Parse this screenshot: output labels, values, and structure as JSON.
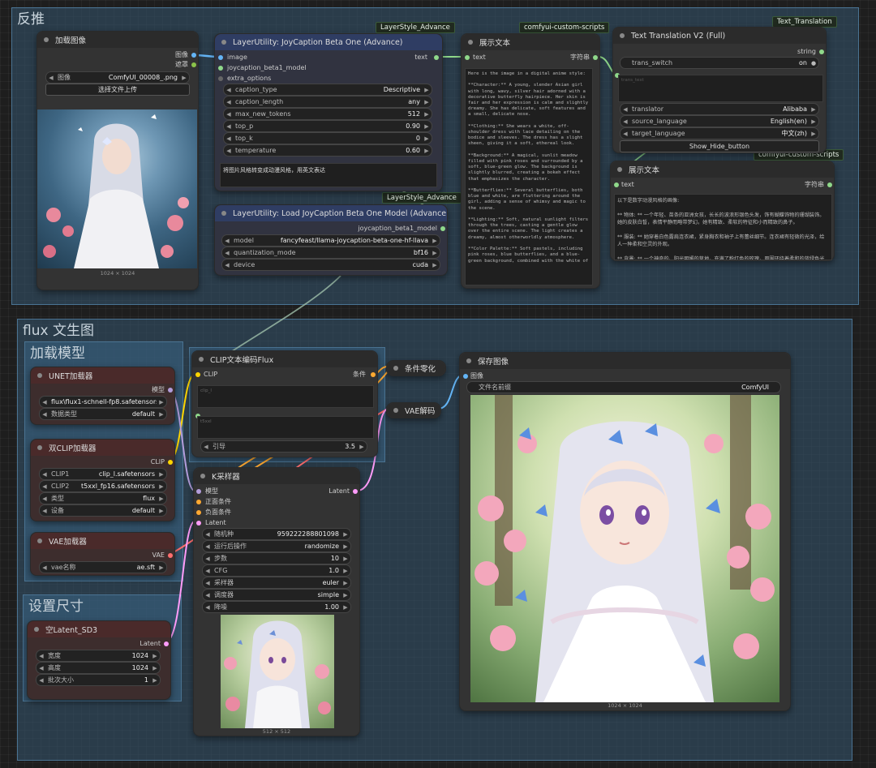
{
  "groups": {
    "reverse": "反推",
    "flux": "flux 文生图",
    "load_model": "加载模型",
    "size": "设置尺寸"
  },
  "badges": {
    "ls_adv_1": "LayerStyle_Advance",
    "ls_adv_2": "LayerStyle_Advance",
    "ccs_1": "comfyui-custom-scripts",
    "ccs_2": "comfyui-custom-scripts",
    "text_translation": "Text_Translation"
  },
  "load_image": {
    "title": "加载图像",
    "out_image": "图像",
    "out_mask": "遮罩",
    "image_label": "图像",
    "image_value": "ComfyUI_00008_.png",
    "upload": "选择文件上传",
    "size": "1024 × 1024"
  },
  "joycap": {
    "title": "LayerUtility: JoyCaption Beta One (Advance)",
    "in_image": "image",
    "in_model": "joycaption_beta1_model",
    "in_extra": "extra_options",
    "out_text": "text",
    "widgets": [
      {
        "label": "caption_type",
        "value": "Descriptive"
      },
      {
        "label": "caption_length",
        "value": "any"
      },
      {
        "label": "max_new_tokens",
        "value": "512"
      },
      {
        "label": "top_p",
        "value": "0.90"
      },
      {
        "label": "top_k",
        "value": "0"
      },
      {
        "label": "temperature",
        "value": "0.60"
      }
    ],
    "prompt": "将图片风格转变成动漫风格，用英文表达"
  },
  "load_joycap": {
    "title": "LayerUtility: Load JoyCaption Beta One Model (Advance)",
    "out": "joycaption_beta1_model",
    "widgets": [
      {
        "label": "model",
        "value": "fancyfeast/llama-joycaption-beta-one-hf-llava"
      },
      {
        "label": "quantization_mode",
        "value": "bf16"
      },
      {
        "label": "device",
        "value": "cuda"
      }
    ]
  },
  "show_text_1": {
    "title": "展示文本",
    "in_text": "text",
    "out": "字符串",
    "content": "Here is the image in a digital anime style:\n\n**Character:** A young, slender Asian girl with long, wavy, silver hair adorned with a decorative butterfly hairpiece. Her skin is fair and her expression is calm and slightly dreamy. She has delicate, soft features and a small, delicate nose.\n\n**Clothing:** She wears a white, off-shoulder dress with lace detailing on the bodice and sleeves. The dress has a slight sheen, giving it a soft, ethereal look.\n\n**Background:** A magical, sunlit meadow filled with pink roses and surrounded by a soft, blue-green glow. The background is slightly blurred, creating a bokeh effect that emphasizes the character.\n\n**Butterflies:** Several butterflies, both blue and white, are fluttering around the girl, adding a sense of whimsy and magic to the scene.\n\n**Lighting:** Soft, natural sunlight filters through the trees, casting a gentle glow over the entire scene. The light creates a dreamy, almost otherworldly atmosphere.\n\n**Color Palette:** Soft pastels, including pink roses, blue butterflies, and a blue-green background, combined with the white of"
  },
  "translation": {
    "title": "Text Translation V2 (Full)",
    "out": "string",
    "switch_label": "trans_switch",
    "switch_value": "on",
    "text_placeholder": "trans_text",
    "widgets": [
      {
        "label": "translator",
        "value": "Alibaba"
      },
      {
        "label": "source_language",
        "value": "English(en)"
      },
      {
        "label": "target_language",
        "value": "中文(zh)"
      }
    ],
    "button": "Show_Hide_button"
  },
  "show_text_2": {
    "title": "展示文本",
    "in_text": "text",
    "out": "字符串",
    "content": "以下是数字动漫风格的画像:\n\n** 物体: ** 一个年轻、苗条的亚洲女孩，长长的波浪形银色头发，饰有蝴蝶饰物的珊瑚装饰。她的皮肤白皙，表情平静而略带梦幻。她有精致、柔软的特征和小而精致的鼻子。\n\n** 服装: ** 她穿着白色露肩连衣裙，紧身胸衣和袖子上有蕾丝细节。连衣裙有轻微的光泽，给人一种柔和空灵的外观。\n\n** 背景: ** 一个神奇的、阳光明媚的草地，充满了粉红色的玫瑰，周围环绕着柔和的蓝绿色光芒。背景略微模糊，产生强调角色的散景效果。"
  },
  "unet": {
    "title": "UNET加载器",
    "out": "模型",
    "widgets": [
      {
        "label": "",
        "value": "flux\\flux1-schnell-fp8.safetensors"
      },
      {
        "label": "数据类型",
        "value": "default"
      }
    ]
  },
  "dualclip": {
    "title": "双CLIP加载器",
    "out": "CLIP",
    "widgets": [
      {
        "label": "CLIP1",
        "value": "clip_l.safetensors"
      },
      {
        "label": "CLIP2",
        "value": "t5xxl_fp16.safetensors"
      },
      {
        "label": "类型",
        "value": "flux"
      },
      {
        "label": "设备",
        "value": "default"
      }
    ]
  },
  "vae_loader": {
    "title": "VAE加载器",
    "out": "VAE",
    "widgets": [
      {
        "label": "vae名称",
        "value": "ae.sft"
      }
    ]
  },
  "latent": {
    "title": "空Latent_SD3",
    "out": "Latent",
    "widgets": [
      {
        "label": "宽度",
        "value": "1024"
      },
      {
        "label": "高度",
        "value": "1024"
      },
      {
        "label": "批次大小",
        "value": "1"
      }
    ]
  },
  "clip_flux": {
    "title": "CLIP文本编码Flux",
    "in_clip": "CLIP",
    "out": "条件",
    "t1_placeholder": "clip_l",
    "t2_placeholder": "t5xxl",
    "guidance_label": "引导",
    "guidance_value": "3.5"
  },
  "zero_out": {
    "title": "条件零化"
  },
  "vae_decode": {
    "title": "VAE解码"
  },
  "ksampler": {
    "title": "K采样器",
    "in_model": "模型",
    "in_pos": "正面条件",
    "in_neg": "负面条件",
    "in_latent": "Latent",
    "out": "Latent",
    "widgets": [
      {
        "label": "随机种",
        "value": "959222288801098"
      },
      {
        "label": "运行后操作",
        "value": "randomize"
      },
      {
        "label": "步数",
        "value": "10"
      },
      {
        "label": "CFG",
        "value": "1.0"
      },
      {
        "label": "采样器",
        "value": "euler"
      },
      {
        "label": "调度器",
        "value": "simple"
      },
      {
        "label": "降噪",
        "value": "1.00"
      }
    ],
    "preview_size": "512 × 512"
  },
  "save_image": {
    "title": "保存图像",
    "in_image": "图像",
    "prefix_label": "文件名前缀",
    "prefix_value": "ComfyUI",
    "size": "1024 × 1024"
  },
  "colors": {
    "image": "#64b5f6",
    "clip": "#ffd500",
    "model": "#b39ddb",
    "conditioning": "#ffa931",
    "latent": "#ff9cf9",
    "vae": "#ff6e6e",
    "string": "#7bcf6b"
  }
}
